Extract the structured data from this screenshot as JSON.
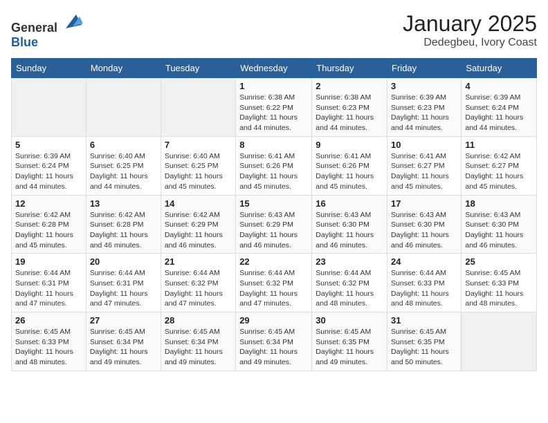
{
  "header": {
    "logo_general": "General",
    "logo_blue": "Blue",
    "title": "January 2025",
    "subtitle": "Dedegbeu, Ivory Coast"
  },
  "calendar": {
    "days_of_week": [
      "Sunday",
      "Monday",
      "Tuesday",
      "Wednesday",
      "Thursday",
      "Friday",
      "Saturday"
    ],
    "weeks": [
      [
        {
          "day": "",
          "info": ""
        },
        {
          "day": "",
          "info": ""
        },
        {
          "day": "",
          "info": ""
        },
        {
          "day": "1",
          "info": "Sunrise: 6:38 AM\nSunset: 6:22 PM\nDaylight: 11 hours and 44 minutes."
        },
        {
          "day": "2",
          "info": "Sunrise: 6:38 AM\nSunset: 6:23 PM\nDaylight: 11 hours and 44 minutes."
        },
        {
          "day": "3",
          "info": "Sunrise: 6:39 AM\nSunset: 6:23 PM\nDaylight: 11 hours and 44 minutes."
        },
        {
          "day": "4",
          "info": "Sunrise: 6:39 AM\nSunset: 6:24 PM\nDaylight: 11 hours and 44 minutes."
        }
      ],
      [
        {
          "day": "5",
          "info": "Sunrise: 6:39 AM\nSunset: 6:24 PM\nDaylight: 11 hours and 44 minutes."
        },
        {
          "day": "6",
          "info": "Sunrise: 6:40 AM\nSunset: 6:25 PM\nDaylight: 11 hours and 44 minutes."
        },
        {
          "day": "7",
          "info": "Sunrise: 6:40 AM\nSunset: 6:25 PM\nDaylight: 11 hours and 45 minutes."
        },
        {
          "day": "8",
          "info": "Sunrise: 6:41 AM\nSunset: 6:26 PM\nDaylight: 11 hours and 45 minutes."
        },
        {
          "day": "9",
          "info": "Sunrise: 6:41 AM\nSunset: 6:26 PM\nDaylight: 11 hours and 45 minutes."
        },
        {
          "day": "10",
          "info": "Sunrise: 6:41 AM\nSunset: 6:27 PM\nDaylight: 11 hours and 45 minutes."
        },
        {
          "day": "11",
          "info": "Sunrise: 6:42 AM\nSunset: 6:27 PM\nDaylight: 11 hours and 45 minutes."
        }
      ],
      [
        {
          "day": "12",
          "info": "Sunrise: 6:42 AM\nSunset: 6:28 PM\nDaylight: 11 hours and 45 minutes."
        },
        {
          "day": "13",
          "info": "Sunrise: 6:42 AM\nSunset: 6:28 PM\nDaylight: 11 hours and 46 minutes."
        },
        {
          "day": "14",
          "info": "Sunrise: 6:42 AM\nSunset: 6:29 PM\nDaylight: 11 hours and 46 minutes."
        },
        {
          "day": "15",
          "info": "Sunrise: 6:43 AM\nSunset: 6:29 PM\nDaylight: 11 hours and 46 minutes."
        },
        {
          "day": "16",
          "info": "Sunrise: 6:43 AM\nSunset: 6:30 PM\nDaylight: 11 hours and 46 minutes."
        },
        {
          "day": "17",
          "info": "Sunrise: 6:43 AM\nSunset: 6:30 PM\nDaylight: 11 hours and 46 minutes."
        },
        {
          "day": "18",
          "info": "Sunrise: 6:43 AM\nSunset: 6:30 PM\nDaylight: 11 hours and 46 minutes."
        }
      ],
      [
        {
          "day": "19",
          "info": "Sunrise: 6:44 AM\nSunset: 6:31 PM\nDaylight: 11 hours and 47 minutes."
        },
        {
          "day": "20",
          "info": "Sunrise: 6:44 AM\nSunset: 6:31 PM\nDaylight: 11 hours and 47 minutes."
        },
        {
          "day": "21",
          "info": "Sunrise: 6:44 AM\nSunset: 6:32 PM\nDaylight: 11 hours and 47 minutes."
        },
        {
          "day": "22",
          "info": "Sunrise: 6:44 AM\nSunset: 6:32 PM\nDaylight: 11 hours and 47 minutes."
        },
        {
          "day": "23",
          "info": "Sunrise: 6:44 AM\nSunset: 6:32 PM\nDaylight: 11 hours and 48 minutes."
        },
        {
          "day": "24",
          "info": "Sunrise: 6:44 AM\nSunset: 6:33 PM\nDaylight: 11 hours and 48 minutes."
        },
        {
          "day": "25",
          "info": "Sunrise: 6:45 AM\nSunset: 6:33 PM\nDaylight: 11 hours and 48 minutes."
        }
      ],
      [
        {
          "day": "26",
          "info": "Sunrise: 6:45 AM\nSunset: 6:33 PM\nDaylight: 11 hours and 48 minutes."
        },
        {
          "day": "27",
          "info": "Sunrise: 6:45 AM\nSunset: 6:34 PM\nDaylight: 11 hours and 49 minutes."
        },
        {
          "day": "28",
          "info": "Sunrise: 6:45 AM\nSunset: 6:34 PM\nDaylight: 11 hours and 49 minutes."
        },
        {
          "day": "29",
          "info": "Sunrise: 6:45 AM\nSunset: 6:34 PM\nDaylight: 11 hours and 49 minutes."
        },
        {
          "day": "30",
          "info": "Sunrise: 6:45 AM\nSunset: 6:35 PM\nDaylight: 11 hours and 49 minutes."
        },
        {
          "day": "31",
          "info": "Sunrise: 6:45 AM\nSunset: 6:35 PM\nDaylight: 11 hours and 50 minutes."
        },
        {
          "day": "",
          "info": ""
        }
      ]
    ]
  }
}
